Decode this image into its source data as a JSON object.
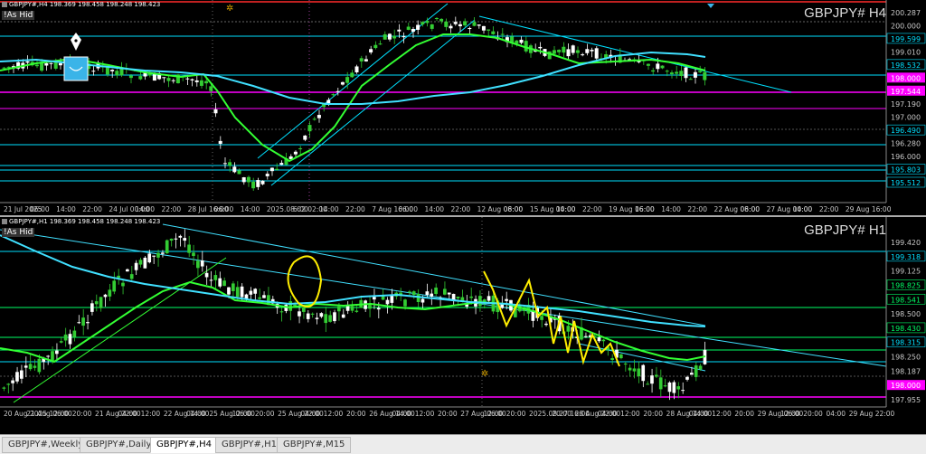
{
  "pane1": {
    "header": "GBPJPY#,H4  198.369 198.458 198.248 198.423",
    "as_hide": "!As Hid",
    "symbol": "GBPJPY# H4",
    "price_labels": [
      {
        "text": "200.287",
        "color": "#c8c8c8",
        "bg": "#000"
      },
      {
        "text": "200.000",
        "color": "#c8c8c8",
        "bg": "#000"
      },
      {
        "text": "199.599",
        "color": "#00e0ff",
        "bg": "#000"
      },
      {
        "text": "199.010",
        "color": "#c8c8c8",
        "bg": "#000"
      },
      {
        "text": "198.532",
        "color": "#00e0ff",
        "bg": "#000"
      },
      {
        "text": "198.000",
        "color": "#ffffff",
        "bg": "#ff00ff"
      },
      {
        "text": "197.544",
        "color": "#ffffff",
        "bg": "#ff00ff"
      },
      {
        "text": "197.190",
        "color": "#c8c8c8",
        "bg": "#000"
      },
      {
        "text": "197.000",
        "color": "#c8c8c8",
        "bg": "#000"
      },
      {
        "text": "196.490",
        "color": "#00e0ff",
        "bg": "#000"
      },
      {
        "text": "196.280",
        "color": "#c8c8c8",
        "bg": "#000"
      },
      {
        "text": "196.000",
        "color": "#c8c8c8",
        "bg": "#000"
      },
      {
        "text": "195.803",
        "color": "#00e0ff",
        "bg": "#000"
      },
      {
        "text": "195.512",
        "color": "#00e0ff",
        "bg": "#000"
      }
    ],
    "time_labels": [
      "21 Jul 2025",
      "06:00",
      "14:00",
      "22:00",
      "24 Jul 00:00",
      "14:00",
      "22:00",
      "28 Jul 16:00",
      "06:00",
      "14:00",
      "2025.08.02 02:00",
      "6:00",
      "14:00",
      "22:00",
      "7 Aug 16:00",
      "06:00",
      "14:00",
      "22:00",
      "12 Aug 08:00",
      "06:00",
      "15 Aug 00:00",
      "14:00",
      "22:00",
      "19 Aug 16:00",
      "06:00",
      "14:00",
      "22:00",
      "22 Aug 08:00",
      "06:00",
      "27 Aug 00:00",
      "14:00",
      "22:00",
      "29 Aug 16:00"
    ],
    "crosshair_label": "2025.08.01 20:00"
  },
  "pane2": {
    "header": "GBPJPY#,H1  198.369 198.458 198.248 198.423",
    "as_hide": "!As Hid",
    "symbol": "GBPJPY# H1",
    "price_labels": [
      {
        "text": "199.420",
        "color": "#c8c8c8",
        "bg": "#000"
      },
      {
        "text": "199.318",
        "color": "#00e0ff",
        "bg": "#000"
      },
      {
        "text": "199.125",
        "color": "#c8c8c8",
        "bg": "#000"
      },
      {
        "text": "198.825",
        "color": "#00ff66",
        "bg": "#000"
      },
      {
        "text": "198.541",
        "color": "#00ff66",
        "bg": "#000"
      },
      {
        "text": "198.500",
        "color": "#c8c8c8",
        "bg": "#000"
      },
      {
        "text": "198.430",
        "color": "#00ff66",
        "bg": "#000"
      },
      {
        "text": "198.315",
        "color": "#00e0ff",
        "bg": "#000"
      },
      {
        "text": "198.250",
        "color": "#c8c8c8",
        "bg": "#000"
      },
      {
        "text": "198.187",
        "color": "#c8c8c8",
        "bg": "#000"
      },
      {
        "text": "198.000",
        "color": "#ffffff",
        "bg": "#ff00ff"
      },
      {
        "text": "197.955",
        "color": "#c8c8c8",
        "bg": "#000"
      }
    ],
    "time_labels": [
      "20 Aug 2025",
      "21 Aug 06:00",
      "12:00",
      "20:00",
      "21 Aug 22:00",
      "04:00",
      "12:00",
      "22 Aug 14:00",
      "04:00",
      "25 Aug 06:00",
      "12:00",
      "20:00",
      "25 Aug 22:00",
      "04:00",
      "12:00",
      "20:00",
      "26 Aug 14:00",
      "04:00",
      "12:00",
      "20:00",
      "27 Aug 06:00",
      "12:00",
      "20:00",
      "2025.08.27 16:00",
      "20:00",
      "28 Aug 22:00",
      "04:00",
      "12:00",
      "20:00",
      "28 Aug 14:00",
      "04:00",
      "12:00",
      "20:00",
      "29 Aug 06:00",
      "12:00",
      "20:00",
      "04:00",
      "29 Aug 22:00"
    ]
  },
  "tabs": [
    "GBPJPY#,Weekly",
    "GBPJPY#,Daily",
    "GBPJPY#,H4",
    "GBPJPY#,H1",
    "GBPJPY#,M15"
  ],
  "active_tab": "GBPJPY#,H4"
}
